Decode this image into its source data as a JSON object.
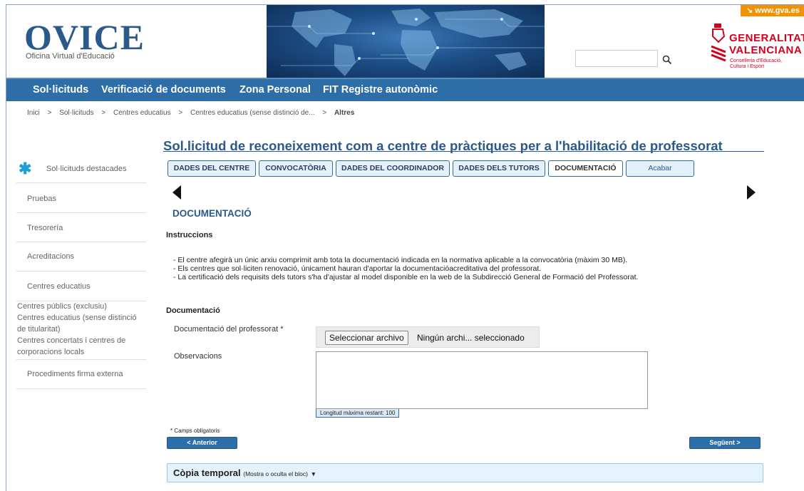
{
  "header": {
    "logo": "OVICE",
    "logo_sub": "Oficina Virtual d'Educació",
    "gva_link": "↘ www.gva.es",
    "gen_line1": "GENERALITAT",
    "gen_line2": "VALENCIANA",
    "gen_line3": "Conselleria d'Educació, Cultura i Esport",
    "search_placeholder": ""
  },
  "nav": [
    "Sol·licituds",
    "Verificació de documents",
    "Zona Personal",
    "FIT Registre autonòmic"
  ],
  "breadcrumb": [
    "Inici",
    ">",
    "Sol·licituds",
    ">",
    "Centres educatius",
    ">",
    "Centres educatius (sense distinció de...",
    ">",
    "Altres"
  ],
  "sidebar": {
    "items": [
      "Sol·licituds destacades",
      "Pruebas",
      "Tresorería",
      "Acreditacions",
      "Centres educatius"
    ],
    "sub_links": [
      "Centres públics (exclusiu)",
      "Centres educatius (sense distinció de titularitat)",
      "Centres concertats i centres de corporacions locals"
    ],
    "last_item": "Procediments firma externa"
  },
  "page_title": "Sol.licitud de reconeixement com a centre de pràctiques per a l'habilitació de professorat",
  "tabs": [
    "DADES DEL CENTRE",
    "CONVOCATÒRIA",
    "DADES DEL COORDINADOR",
    "DADES DELS TUTORS",
    "DOCUMENTACIÓ",
    "Acabar"
  ],
  "active_tab": "DOCUMENTACIÓ",
  "section_title": "DOCUMENTACIÓ",
  "instructions_label": "Instruccions",
  "instructions": [
    "- El centre afegirà un únic arxiu comprimit amb tota la documentació indicada en la normativa aplicable a la convocatòria (màxim 30 MB).",
    "- Els centres que sol·liciten renovació, únicament hauran d'aportar la documentacióacreditativa del professorat.",
    "- La certificació dels requisits dels tutors s'ha d'ajustar al model disponible en la web de la Subdirecció General de Formació del Professorat."
  ],
  "documentacio_label": "Documentació",
  "field_doc_label": "Documentació del professorat *",
  "file_button": "Seleccionar archivo",
  "file_status": "Ningún archi... seleccionado",
  "field_obs_label": "Observacions",
  "obs_value": "",
  "maxlen_text": "Longitud màxima restant: 100",
  "required_note": "* Camps obligatoris",
  "btn_prev": "< Anterior",
  "btn_next": "Següent >",
  "copia_title": "Còpia temporal",
  "copia_sub": "(Mostra o oculta el bloc)",
  "copia_caret": "▼",
  "colors": {
    "nav": "#2e6ea8",
    "title": "#2a5a8c",
    "gen_red": "#d6001c",
    "gva_orange": "#f39200"
  }
}
